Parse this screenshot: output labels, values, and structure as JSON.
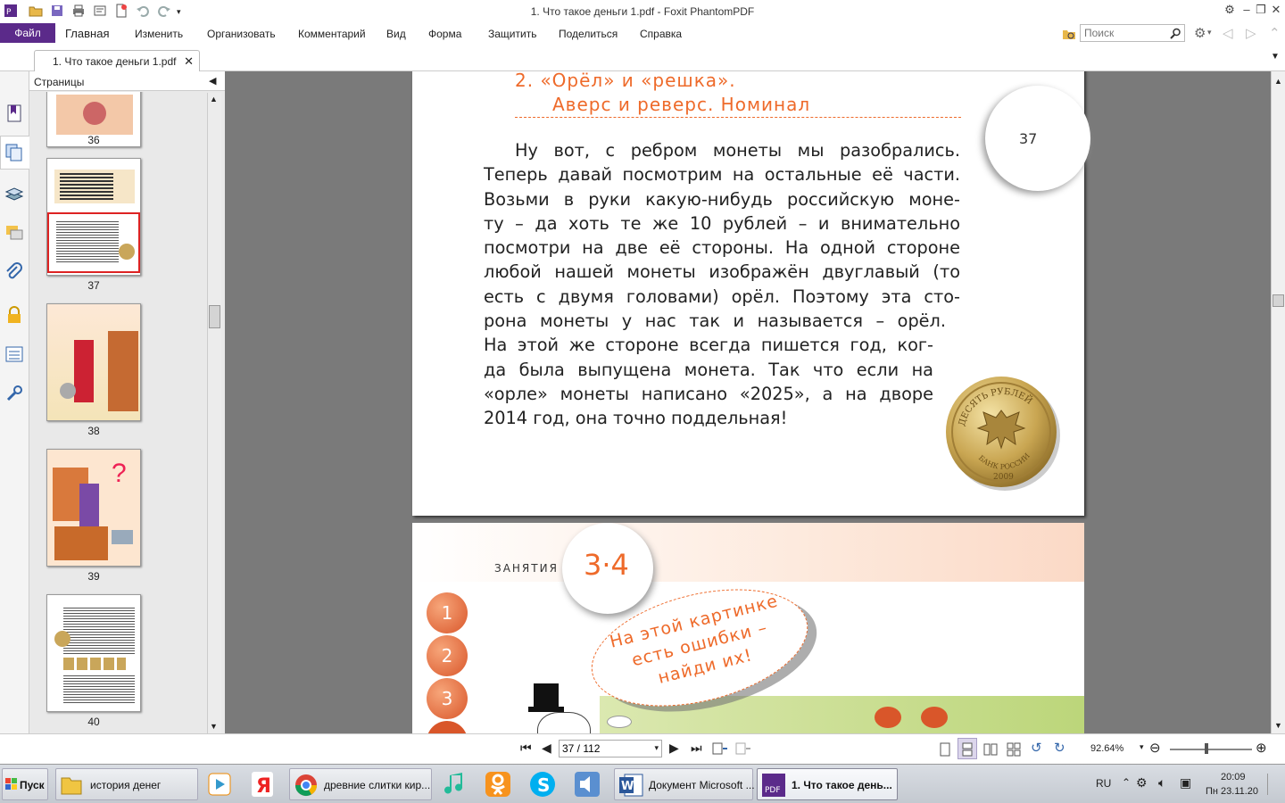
{
  "window": {
    "title": "1. Что такое деньги 1.pdf - Foxit PhantomPDF"
  },
  "menu": {
    "file": "Файл",
    "items": [
      "Главная",
      "Изменить",
      "Организовать",
      "Комментарий",
      "Вид",
      "Форма",
      "Защитить",
      "Поделиться",
      "Справка"
    ]
  },
  "search": {
    "placeholder": "Поиск"
  },
  "tab": {
    "label": "1. Что такое деньги 1.pdf"
  },
  "panel": {
    "title": "Страницы",
    "thumbnails": [
      {
        "label": "36"
      },
      {
        "label": "37"
      },
      {
        "label": "38"
      },
      {
        "label": "39"
      },
      {
        "label": "40"
      }
    ]
  },
  "page37": {
    "heading_line1": "2.  «Орёл»  и  «решка».",
    "heading_line2": "Аверс  и  реверс.  Номинал",
    "page_number": "37",
    "paragraph": [
      "Ну вот, с ребром монеты мы разобрались.",
      "Теперь давай посмотрим на остальные её части.",
      "Возьми в руки какую-нибудь российскую моне-",
      "ту – да хоть те же 10 рублей – и внимательно",
      "посмотри на две её стороны. На одной стороне",
      "любой нашей монеты изображён двуглавый (то",
      "есть с двумя головами) орёл. Поэтому эта сто-",
      "рона монеты у нас так и называется – орёл.",
      "На этой же стороне всегда пишется год, ког-",
      "да была выпущена монета. Так что если на",
      "«орле» монеты написано «2025», а на дворе",
      "2014 год, она точно поддельная!"
    ],
    "coin": {
      "top_text": "ДЕСЯТЬ РУБЛЕЙ",
      "bottom_text": "БАНК РОССИИ",
      "year": "2009"
    }
  },
  "page38": {
    "section_label": "ЗАНЯТИЯ",
    "section_number": "3·4",
    "steps": [
      "1",
      "2",
      "3"
    ],
    "bubble": [
      "На  этой  картинке",
      "есть  ошибки  –",
      "найди  их!"
    ]
  },
  "status": {
    "page_value": "37 / 112",
    "zoom": "92.64%"
  },
  "taskbar": {
    "start": "Пуск",
    "items": [
      {
        "label": "история денег"
      },
      {
        "label": "древние слитки кир..."
      },
      {
        "label": "Документ Microsoft ..."
      },
      {
        "label": "1. Что такое день..."
      }
    ],
    "lang": "RU",
    "time": "20:09",
    "date": "Пн 23.11.20"
  },
  "colors": {
    "accent": "#5b2a8a",
    "heading": "#ee6a2a",
    "page_bg": "#7a7a7a"
  }
}
